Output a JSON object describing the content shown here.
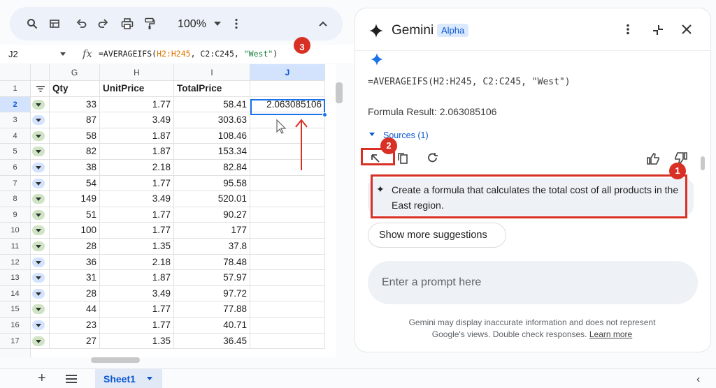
{
  "colors": {
    "accent": "#0b57d0",
    "annotation": "#d93025",
    "panel_bg": "#ffffff",
    "toolbar_bg": "#edf2fa"
  },
  "toolbar": {
    "zoom": "100%",
    "icons": [
      "search-icon",
      "table-icon",
      "undo-icon",
      "redo-icon",
      "print-icon",
      "paint-format-icon",
      "kebab-icon",
      "chevron-up-icon"
    ]
  },
  "formula_bar": {
    "cell_ref": "J2",
    "fx": "fx",
    "formula_prefix": "=AVERAGEIFS(",
    "formula_arg1": "H2:H245",
    "formula_sep1": ", ",
    "formula_arg2": "C2:C245",
    "formula_sep2": ", ",
    "formula_arg3": "\"West\"",
    "formula_suffix": ")"
  },
  "sheet": {
    "columns": [
      "G",
      "H",
      "I",
      "J"
    ],
    "headers": [
      "Qty",
      "UnitPrice",
      "TotalPrice",
      ""
    ],
    "selected_value": "2.063085106",
    "rows": [
      {
        "n": "2",
        "qty": "33",
        "unit": "1.77",
        "total": "58.41"
      },
      {
        "n": "3",
        "qty": "87",
        "unit": "3.49",
        "total": "303.63"
      },
      {
        "n": "4",
        "qty": "58",
        "unit": "1.87",
        "total": "108.46"
      },
      {
        "n": "5",
        "qty": "82",
        "unit": "1.87",
        "total": "153.34"
      },
      {
        "n": "6",
        "qty": "38",
        "unit": "2.18",
        "total": "82.84"
      },
      {
        "n": "7",
        "qty": "54",
        "unit": "1.77",
        "total": "95.58"
      },
      {
        "n": "8",
        "qty": "149",
        "unit": "3.49",
        "total": "520.01"
      },
      {
        "n": "9",
        "qty": "51",
        "unit": "1.77",
        "total": "90.27"
      },
      {
        "n": "10",
        "qty": "100",
        "unit": "1.77",
        "total": "177"
      },
      {
        "n": "11",
        "qty": "28",
        "unit": "1.35",
        "total": "37.8"
      },
      {
        "n": "12",
        "qty": "36",
        "unit": "2.18",
        "total": "78.48"
      },
      {
        "n": "13",
        "qty": "31",
        "unit": "1.87",
        "total": "57.97"
      },
      {
        "n": "14",
        "qty": "28",
        "unit": "3.49",
        "total": "97.72"
      },
      {
        "n": "15",
        "qty": "44",
        "unit": "1.77",
        "total": "77.88"
      },
      {
        "n": "16",
        "qty": "23",
        "unit": "1.77",
        "total": "40.71"
      },
      {
        "n": "17",
        "qty": "27",
        "unit": "1.35",
        "total": "36.45"
      }
    ],
    "chip_colors": [
      "#cfe3c5",
      "#d3e3fd",
      "#cfe3c5",
      "#cfe3c5",
      "#d3e3fd",
      "#d3e3fd",
      "#cfe3c5",
      "#cfe3c5",
      "#cfe3c5",
      "#cfe3c5",
      "#d3e3fd",
      "#d3e3fd",
      "#d3e3fd",
      "#cfe3c5",
      "#d3e3fd",
      "#cfe3c5"
    ]
  },
  "bottom_bar": {
    "sheet_tab": "Sheet1",
    "add": "+"
  },
  "gemini": {
    "title": "Gemini",
    "badge": "Alpha",
    "formula": "=AVERAGEIFS(H2:H245, C2:C245, \"West\")",
    "result": "Formula Result: 2.063085106",
    "sources": "Sources (1)",
    "suggestion": "Create a formula that calculates the total cost of all products in the East region.",
    "show_more": "Show more suggestions",
    "prompt_placeholder": "Enter a prompt here",
    "disclaimer": "Gemini may display inaccurate information and does not represent Google's views. Double check responses.",
    "learn_more": "Learn more"
  },
  "annotations": {
    "marker_1": "1",
    "marker_2": "2",
    "marker_3": "3"
  }
}
